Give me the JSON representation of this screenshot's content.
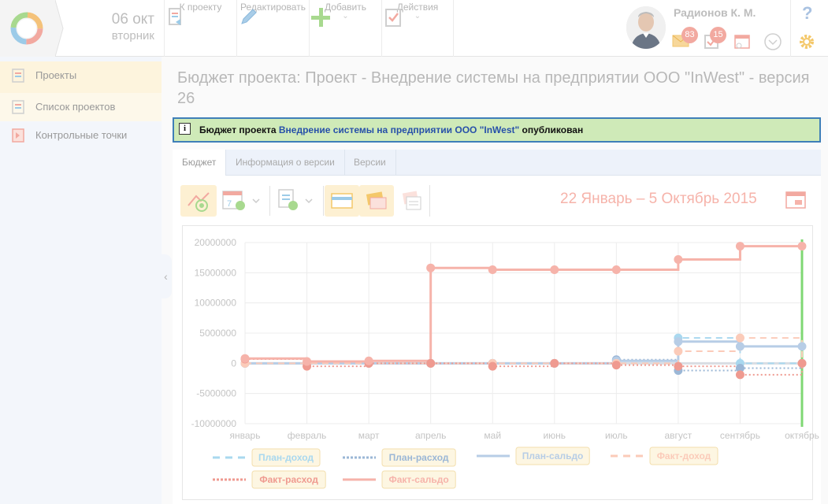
{
  "header": {
    "date_day": "06 окт",
    "date_weekday": "вторник",
    "toolbar": [
      {
        "label": "К проекту",
        "icon": "back-to-project-icon",
        "dropdown": false
      },
      {
        "label": "Редактировать",
        "icon": "pencil-icon",
        "dropdown": false
      },
      {
        "label": "Добавить",
        "icon": "plus-icon",
        "dropdown": true
      },
      {
        "label": "Действия",
        "icon": "clipboard-check-icon",
        "dropdown": true
      }
    ],
    "user_name": "Радионов К. М.",
    "badges": {
      "messages": "83",
      "tasks": "15"
    },
    "help_icon": "question-icon",
    "settings_icon": "gear-icon"
  },
  "sidebar": {
    "items": [
      {
        "label": "Проекты",
        "icon": "projects-icon",
        "active": true
      },
      {
        "label": "Список проектов",
        "icon": "project-list-icon",
        "active": false
      },
      {
        "label": "Контрольные точки",
        "icon": "milestones-icon",
        "active": false
      }
    ]
  },
  "page": {
    "title": "Бюджет проекта: Проект - Внедрение системы на предприятии ООО \"InWest\" - версия 26",
    "info_prefix": "Бюджет проекта",
    "info_link": "Внедрение системы на предприятии ООО \"InWest\"",
    "info_suffix": "опубликован",
    "tabs": [
      "Бюджет",
      "Информация о версии",
      "Версии"
    ],
    "active_tab": 0,
    "date_range": "22 Январь – 5 Октябрь 2015"
  },
  "colors": {
    "accent": "#2750a9",
    "info_bg": "#cfeab8",
    "info_border": "#3f7fb8",
    "plan_income": "#a9d8ef",
    "plan_expense": "#9bb7d6",
    "plan_balance": "#b7cde6",
    "fact_income": "#fbcbb9",
    "fact_expense": "#ef9a90",
    "fact_balance": "#f6b3aa",
    "today_line": "#7fd873"
  },
  "chart_data": {
    "type": "line",
    "step": true,
    "categories": [
      "январь",
      "февраль",
      "март",
      "апрель",
      "май",
      "июнь",
      "июль",
      "август",
      "сентябрь",
      "октябрь"
    ],
    "ylim": [
      -10000000,
      20000000
    ],
    "yticks": [
      20000000,
      15000000,
      10000000,
      5000000,
      0,
      -5000000,
      -10000000
    ],
    "ytick_labels": [
      "20000000",
      "15000000",
      "10000000",
      "5000000",
      "0",
      "-5000000",
      "-10000000"
    ],
    "grid": true,
    "legend_position": "bottom",
    "series": [
      {
        "name": "План-доход",
        "style": "dashed",
        "color": "#a9d8ef",
        "values": [
          0,
          0,
          0,
          0,
          0,
          0,
          0,
          4200000,
          0,
          0
        ]
      },
      {
        "name": "План-расход",
        "style": "dotted",
        "color": "#9bb7d6",
        "values": [
          0,
          0,
          0,
          0,
          0,
          0,
          600000,
          -1200000,
          -800000,
          0
        ]
      },
      {
        "name": "План-сальдо",
        "style": "solid",
        "color": "#b7cde6",
        "values": [
          0,
          0,
          0,
          0,
          0,
          0,
          400000,
          3600000,
          2800000,
          2800000
        ]
      },
      {
        "name": "Факт-доход",
        "style": "dashed",
        "color": "#fbcbb9",
        "values": [
          0,
          0,
          0,
          0,
          0,
          0,
          0,
          2000000,
          4200000,
          0
        ]
      },
      {
        "name": "Факт-расход",
        "style": "dotted",
        "color": "#ef9a90",
        "values": [
          700000,
          -500000,
          0,
          0,
          -500000,
          0,
          -300000,
          -500000,
          -1900000,
          0
        ]
      },
      {
        "name": "Факт-сальдо",
        "style": "solid",
        "color": "#f6b3aa",
        "values": [
          800000,
          300000,
          400000,
          15800000,
          15500000,
          15500000,
          15500000,
          17200000,
          19400000,
          19400000
        ]
      }
    ],
    "today_marker": "октябрь"
  }
}
